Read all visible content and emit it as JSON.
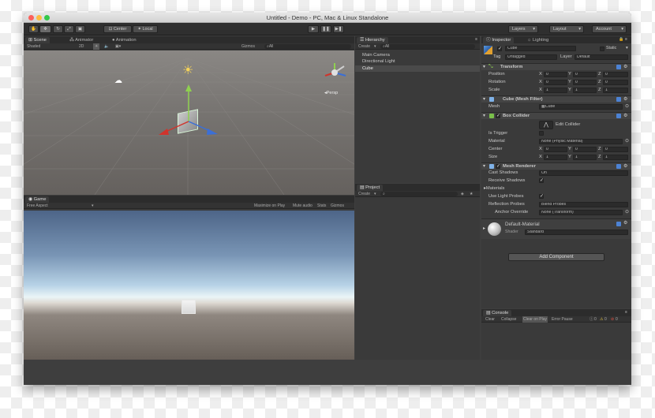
{
  "window": {
    "title": "Untitled - Demo - PC, Mac & Linux Standalone"
  },
  "toolbar": {
    "pivot": "Center",
    "space": "Local",
    "layers": "Layers",
    "layout": "Layout",
    "account": "Account"
  },
  "scene": {
    "tab": "Scene",
    "tab2": "Animator",
    "tab3": "Animation",
    "shading": "Shaded",
    "mode": "2D",
    "gizmos": "Gizmos",
    "search": "All",
    "persp": "Persp"
  },
  "game": {
    "tab": "Game",
    "aspect": "Free Aspect",
    "max": "Maximize on Play",
    "mute": "Mute audio",
    "stats": "Stats",
    "gizmos": "Gizmos"
  },
  "hierarchy": {
    "tab": "Hierarchy",
    "create": "Create",
    "search": "All",
    "items": [
      "Main Camera",
      "Directional Light",
      "Cube"
    ]
  },
  "project": {
    "tab": "Project",
    "create": "Create"
  },
  "console": {
    "tab": "Console",
    "buttons": [
      "Clear",
      "Collapse",
      "Clear on Play",
      "Error Pause"
    ],
    "counts": [
      "0",
      "0",
      "0"
    ]
  },
  "inspector": {
    "tab": "Inspector",
    "tab2": "Lighting",
    "name": "Cube",
    "static": "Static",
    "tag_label": "Tag",
    "tag": "Untagged",
    "layer_label": "Layer",
    "layer": "Default",
    "transform": {
      "title": "Transform",
      "rows": [
        {
          "label": "Position",
          "x": "0",
          "y": "0",
          "z": "0"
        },
        {
          "label": "Rotation",
          "x": "0",
          "y": "0",
          "z": "0"
        },
        {
          "label": "Scale",
          "x": "1",
          "y": "1",
          "z": "1"
        }
      ]
    },
    "meshfilter": {
      "title": "Cube (Mesh Filter)",
      "label": "Mesh",
      "value": "Cube"
    },
    "collider": {
      "title": "Box Collider",
      "edit": "Edit Collider",
      "trigger": "Is Trigger",
      "material_label": "Material",
      "material": "None (Physic Material)",
      "center_label": "Center",
      "cx": "0",
      "cy": "0",
      "cz": "0",
      "size_label": "Size",
      "sx": "1",
      "sy": "1",
      "sz": "1"
    },
    "renderer": {
      "title": "Mesh Renderer",
      "cast_label": "Cast Shadows",
      "cast": "On",
      "receive": "Receive Shadows",
      "materials": "Materials",
      "probes": "Use Light Probes",
      "refl_label": "Reflection Probes",
      "refl": "Blend Probes",
      "anchor_label": "Anchor Override",
      "anchor": "None (Transform)"
    },
    "material": {
      "name": "Default-Material",
      "shader_label": "Shader",
      "shader": "Standard"
    },
    "add": "Add Component"
  }
}
